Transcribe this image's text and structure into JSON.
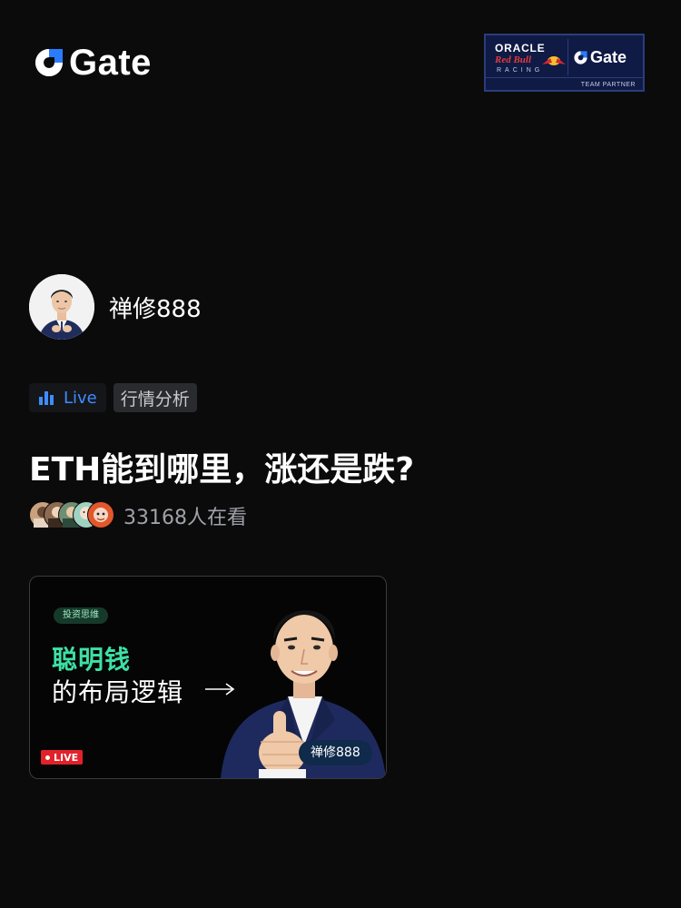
{
  "brand": {
    "logo_text": "Gate",
    "logo_icon": "gate-logo-icon",
    "accent": "#2a7cff",
    "green": "#3ee0a5"
  },
  "partner": {
    "oracle": "ORACLE",
    "redbull": "Red Bull",
    "racing": "RACING",
    "gate": "Gate",
    "team_partner": "TEAM PARTNER"
  },
  "host": {
    "name": "禅修888",
    "avatar_icon": "host-avatar"
  },
  "tags": {
    "live_label": "Live",
    "live_icon": "bar-chart-icon",
    "topic": "行情分析"
  },
  "title": "ETH能到哪里，涨还是跌?",
  "viewers": {
    "count_text": "33168人在看",
    "avatar_colors": [
      "#c8a27e",
      "#8c6b52",
      "#6e8f73",
      "#e2572b"
    ]
  },
  "card": {
    "tag": "投资思维",
    "line1": "聪明钱",
    "line2": "的布局逻辑",
    "arrow_icon": "arrow-right-icon",
    "live_badge": "LIVE",
    "name_pill": "禅修888"
  }
}
